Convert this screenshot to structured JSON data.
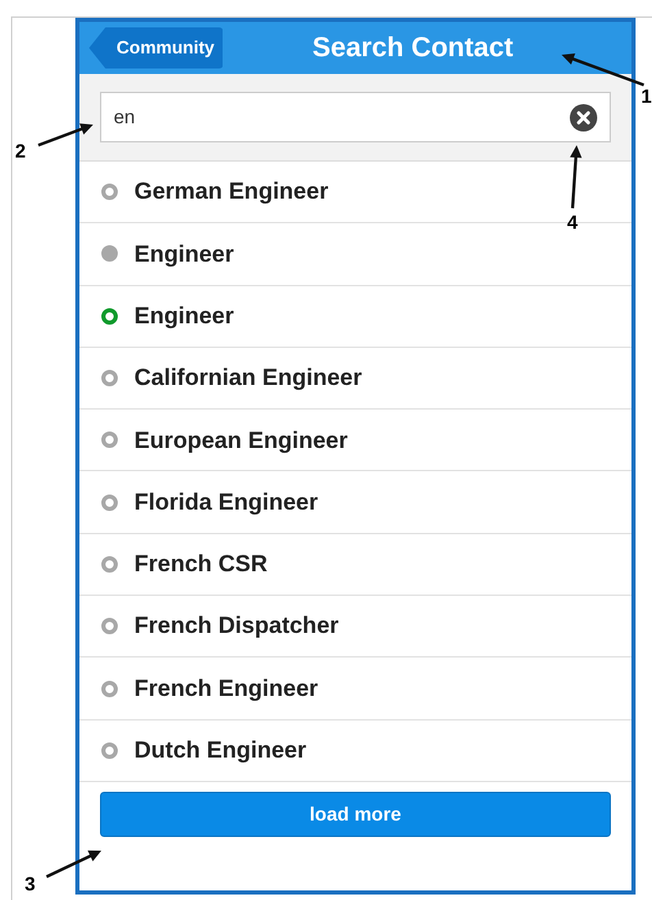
{
  "header": {
    "back_button": "Community",
    "title": "Search Contact"
  },
  "search": {
    "value": "en"
  },
  "contacts": [
    {
      "name": "German Engineer",
      "kind": "ring",
      "color": "#a8a8a8"
    },
    {
      "name": "Engineer",
      "kind": "dot",
      "color": "#a8a8a8"
    },
    {
      "name": "Engineer",
      "kind": "ring",
      "color": "#109a2c"
    },
    {
      "name": "Californian Engineer",
      "kind": "ring",
      "color": "#a8a8a8"
    },
    {
      "name": "European Engineer",
      "kind": "ring",
      "color": "#a8a8a8"
    },
    {
      "name": "Florida Engineer",
      "kind": "ring",
      "color": "#a8a8a8"
    },
    {
      "name": "French CSR",
      "kind": "ring",
      "color": "#a8a8a8"
    },
    {
      "name": "French Dispatcher",
      "kind": "ring",
      "color": "#a8a8a8"
    },
    {
      "name": "French Engineer",
      "kind": "ring",
      "color": "#a8a8a8"
    },
    {
      "name": "Dutch Engineer",
      "kind": "ring",
      "color": "#a8a8a8"
    }
  ],
  "load_more_button": "load more",
  "annotations": [
    {
      "label": "1"
    },
    {
      "label": "2"
    },
    {
      "label": "3"
    },
    {
      "label": "4"
    }
  ]
}
